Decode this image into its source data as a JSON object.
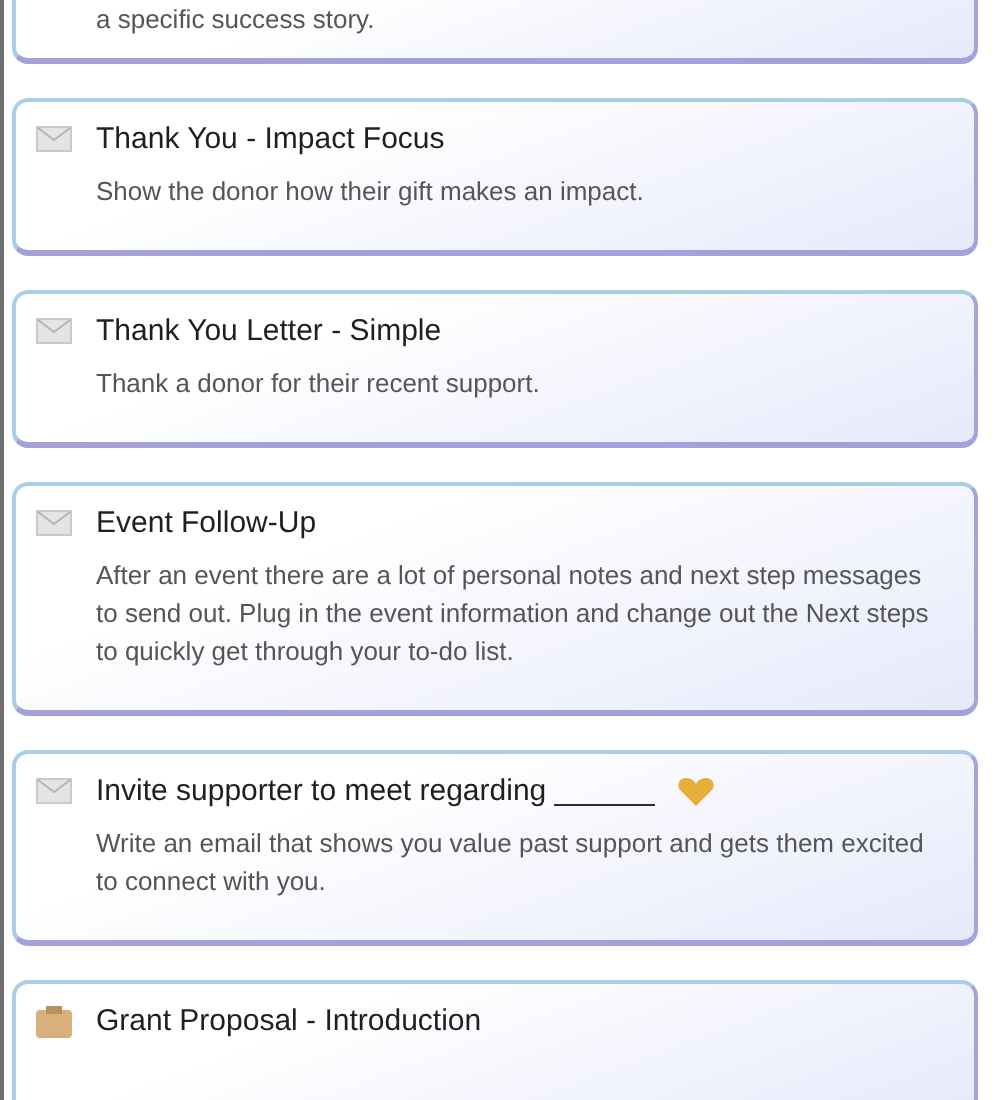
{
  "templates": [
    {
      "kind": "partial",
      "description": "a specific success story."
    },
    {
      "kind": "email",
      "title": "Thank You - Impact Focus",
      "description": "Show the donor how their gift makes an impact."
    },
    {
      "kind": "email",
      "title": "Thank You Letter - Simple",
      "description": "Thank a donor for their recent support."
    },
    {
      "kind": "email",
      "title": "Event Follow-Up",
      "description": "After an event there are a lot of personal notes and next step messages to send out. Plug in the event information and change out the Next steps to quickly get through your to-do list."
    },
    {
      "kind": "invite",
      "title": "Invite supporter to meet regarding ______",
      "description": "Write an email that shows you value past support and gets them excited to connect with you."
    },
    {
      "kind": "grant",
      "title": "Grant Proposal - Introduction"
    }
  ]
}
